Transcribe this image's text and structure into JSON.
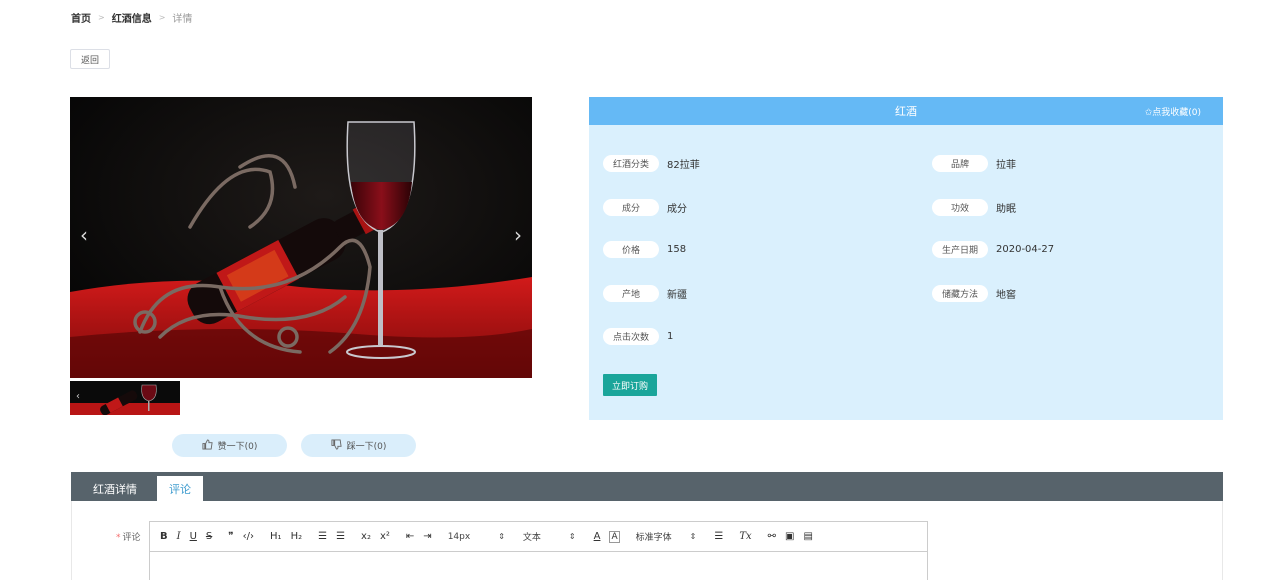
{
  "breadcrumb": {
    "home": "首页",
    "section": "红酒信息",
    "current": "详情",
    "separator": ">"
  },
  "back_button": "返回",
  "carousel": {
    "prev_icon": "‹",
    "next_icon": "›",
    "thumb_icon": "‹"
  },
  "product": {
    "title": "红酒",
    "favorite_label": "✩点我收藏(0)",
    "fields": [
      {
        "label": "红酒分类",
        "value": "82拉菲"
      },
      {
        "label": "品牌",
        "value": "拉菲"
      },
      {
        "label": "成分",
        "value": "成分"
      },
      {
        "label": "功效",
        "value": "助眠"
      },
      {
        "label": "价格",
        "value": "158"
      },
      {
        "label": "生产日期",
        "value": "2020-04-27"
      },
      {
        "label": "产地",
        "value": "新疆"
      },
      {
        "label": "储藏方法",
        "value": "地窖"
      },
      {
        "label": "点击次数",
        "value": "1"
      }
    ],
    "buy_button": "立即订购"
  },
  "votes": {
    "like_label": "赞一下(0)",
    "like_icon": "thumbs-up-icon",
    "dislike_label": "踩一下(0)",
    "dislike_icon": "thumbs-down-icon"
  },
  "tabs": [
    {
      "label": "红酒详情",
      "active": false
    },
    {
      "label": "评论",
      "active": true
    }
  ],
  "comment": {
    "required_mark": "*",
    "label": "评论",
    "toolbar": {
      "bold": "B",
      "italic": "I",
      "underline": "U",
      "strike": "S",
      "quote": "❞",
      "code": "‹/›",
      "h1": "H₁",
      "h2": "H₂",
      "ordered_list": "☰",
      "bullet_list": "☰",
      "subscript": "x₂",
      "superscript": "x²",
      "indent_left": "⇤",
      "indent_right": "⇥",
      "font_size": "14px",
      "text_type": "文本",
      "font_family": "标准字体",
      "color": "A",
      "background": "A",
      "align": "☰",
      "clear": "Tx",
      "link": "⚯",
      "image": "▣",
      "video": "▤"
    }
  },
  "colors": {
    "panel_header": "#65b9f5",
    "panel_bg": "#daf0fd",
    "buy_button": "#1aa59a",
    "tabs_bar": "#57636b",
    "active_tab_text": "#3f9ccf"
  }
}
